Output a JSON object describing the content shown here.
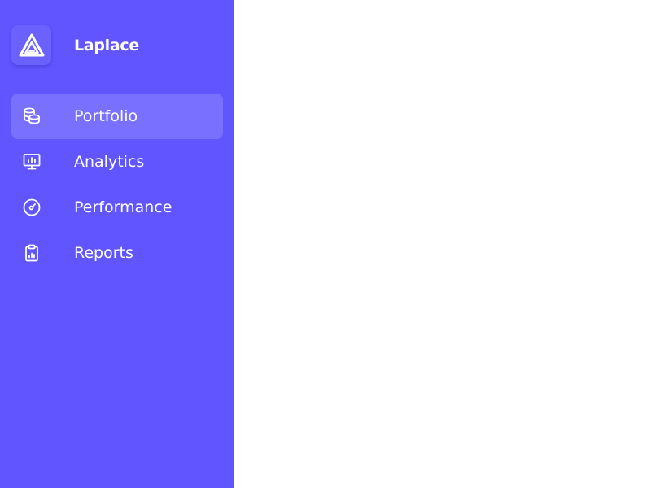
{
  "brand": {
    "name": "Laplace",
    "logo_icon": "triangle-logo-icon"
  },
  "sidebar": {
    "background": "#6155ff",
    "active_index": 0,
    "items": [
      {
        "label": "Portfolio",
        "icon": "coins-icon",
        "active": true
      },
      {
        "label": "Analytics",
        "icon": "presentation-chart-icon",
        "active": false
      },
      {
        "label": "Performance",
        "icon": "gauge-icon",
        "active": false
      },
      {
        "label": "Reports",
        "icon": "clipboard-chart-icon",
        "active": false
      }
    ]
  },
  "colors": {
    "sidebar": "#6155ff",
    "main": "#ffffff",
    "text": "#ffffff"
  }
}
